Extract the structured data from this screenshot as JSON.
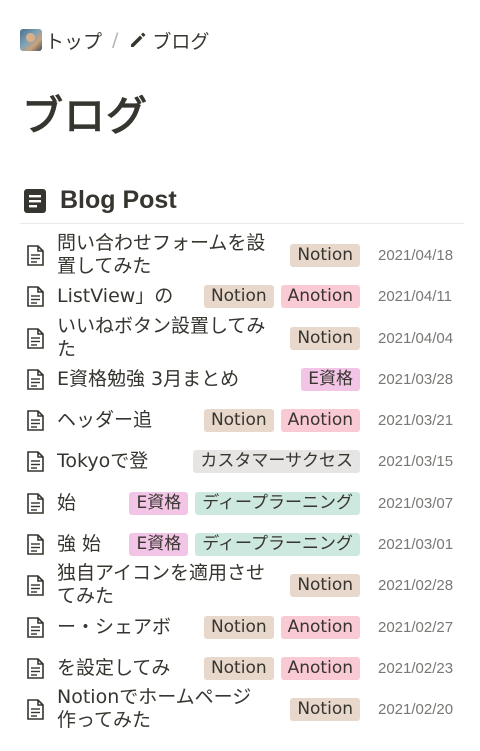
{
  "breadcrumb": {
    "home_label": "トップ",
    "separator": "/",
    "current_label": "ブログ",
    "home_icon": "avatar-photo",
    "current_icon": "pencil-icon"
  },
  "page": {
    "title": "ブログ"
  },
  "database": {
    "title": "Blog Post",
    "icon": "document-list-icon"
  },
  "tag_colors": {
    "Notion": "#e8d7cb",
    "Anotion": "#f9c9d4",
    "E資格": "#f2c4e6",
    "ディープラーニング": "#cde8df",
    "カスタマーサクセス": "#e6e5e3"
  },
  "posts": [
    {
      "title": "問い合わせフォームを設置してみた",
      "tags": [
        "Notion"
      ],
      "date": "2021/04/18"
    },
    {
      "title": "ListView」の",
      "tags": [
        "Notion",
        "Anotion"
      ],
      "date": "2021/04/11"
    },
    {
      "title": "いいねボタン設置してみた",
      "tags": [
        "Notion"
      ],
      "date": "2021/04/04"
    },
    {
      "title": "E資格勉強 3月まとめ",
      "tags": [
        "E資格"
      ],
      "date": "2021/03/28"
    },
    {
      "title": "ヘッダー追",
      "tags": [
        "Notion",
        "Anotion"
      ],
      "date": "2021/03/21"
    },
    {
      "title": "Tokyoで登",
      "tags": [
        "カスタマーサクセス"
      ],
      "date": "2021/03/15"
    },
    {
      "title": "始",
      "tags": [
        "E資格",
        "ディープラーニング"
      ],
      "date": "2021/03/07"
    },
    {
      "title": "強 始",
      "tags": [
        "E資格",
        "ディープラーニング"
      ],
      "date": "2021/03/01"
    },
    {
      "title": "独自アイコンを適用させてみた",
      "tags": [
        "Notion"
      ],
      "date": "2021/02/28"
    },
    {
      "title": "ー・シェアボ",
      "tags": [
        "Notion",
        "Anotion"
      ],
      "date": "2021/02/27"
    },
    {
      "title": "を設定してみ",
      "tags": [
        "Notion",
        "Anotion"
      ],
      "date": "2021/02/23"
    },
    {
      "title": "Notionでホームページ作ってみた",
      "tags": [
        "Notion"
      ],
      "date": "2021/02/20"
    }
  ]
}
